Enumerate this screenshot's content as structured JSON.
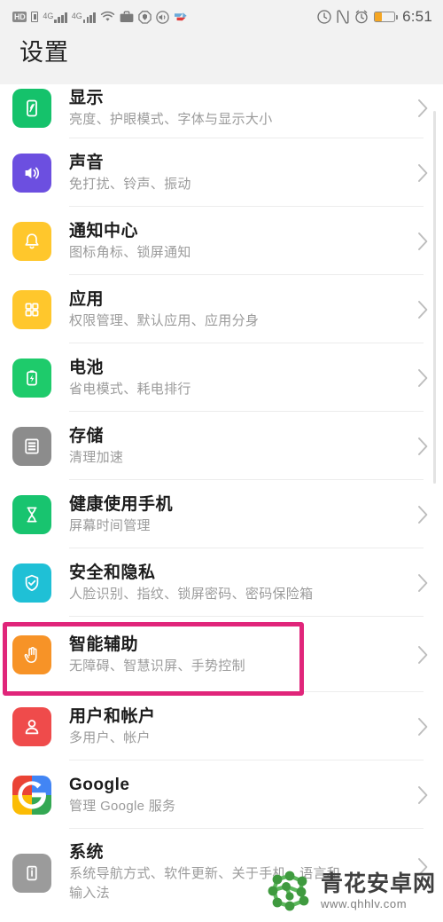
{
  "statusbar": {
    "hd_label": "HD",
    "network_label_1": "4G",
    "network_label_2": "4G",
    "time": "6:51",
    "left_icons": [
      "hd-badge",
      "sim-card-icon",
      "signal-4g-icon",
      "signal-4g-secondary-icon",
      "wifi-icon",
      "briefcase-icon",
      "shield-octagon-icon",
      "sound-off-icon",
      "app-logo-icon"
    ],
    "right_icons": [
      "data-saver-icon",
      "nfc-icon",
      "alarm-icon",
      "battery-icon"
    ],
    "battery_level_percent": 34
  },
  "header": {
    "title": "设置"
  },
  "colors": {
    "highlight": "#e0257a",
    "accent_display": "#15c26b",
    "accent_sound": "#6c4fe0",
    "accent_notification": "#ffc72c",
    "accent_apps": "#ffc72c",
    "accent_battery": "#1ecb6b",
    "accent_storage": "#8c8c8c",
    "accent_health": "#18c46f",
    "accent_security": "#1fc0d6",
    "accent_assist": "#f79327",
    "accent_users": "#ef4b4b",
    "accent_system": "#9b9b9b"
  },
  "list": {
    "items": [
      {
        "id": "display",
        "icon": "display-phone-icon",
        "title": "显示",
        "subtitle": "亮度、护眼模式、字体与显示大小",
        "chevron": "chevron-right-icon",
        "highlighted": false
      },
      {
        "id": "sound",
        "icon": "speaker-icon",
        "title": "声音",
        "subtitle": "免打扰、铃声、振动",
        "chevron": "chevron-right-icon",
        "highlighted": false
      },
      {
        "id": "notification-center",
        "icon": "bell-icon",
        "title": "通知中心",
        "subtitle": "图标角标、锁屏通知",
        "chevron": "chevron-right-icon",
        "highlighted": false
      },
      {
        "id": "apps",
        "icon": "apps-grid-icon",
        "title": "应用",
        "subtitle": "权限管理、默认应用、应用分身",
        "chevron": "chevron-right-icon",
        "highlighted": false
      },
      {
        "id": "battery",
        "icon": "battery-bolt-icon",
        "title": "电池",
        "subtitle": "省电模式、耗电排行",
        "chevron": "chevron-right-icon",
        "highlighted": false
      },
      {
        "id": "storage",
        "icon": "storage-icon",
        "title": "存储",
        "subtitle": "清理加速",
        "chevron": "chevron-right-icon",
        "highlighted": false
      },
      {
        "id": "digital-balance",
        "icon": "hourglass-icon",
        "title": "健康使用手机",
        "subtitle": "屏幕时间管理",
        "chevron": "chevron-right-icon",
        "highlighted": false
      },
      {
        "id": "security-privacy",
        "icon": "shield-check-icon",
        "title": "安全和隐私",
        "subtitle": "人脸识别、指纹、锁屏密码、密码保险箱",
        "chevron": "chevron-right-icon",
        "highlighted": false
      },
      {
        "id": "smart-assistance",
        "icon": "hand-icon",
        "title": "智能辅助",
        "subtitle": "无障碍、智慧识屏、手势控制",
        "chevron": "chevron-right-icon",
        "highlighted": true
      },
      {
        "id": "users-accounts",
        "icon": "user-icon",
        "title": "用户和帐户",
        "subtitle": "多用户、帐户",
        "chevron": "chevron-right-icon",
        "highlighted": false
      },
      {
        "id": "google",
        "icon": "google-g-icon",
        "title": "Google",
        "subtitle": "管理 Google 服务",
        "chevron": "chevron-right-icon",
        "highlighted": false
      },
      {
        "id": "system",
        "icon": "info-icon",
        "title": "系统",
        "subtitle": "系统导航方式、软件更新、关于手机、语言和",
        "subtitle2": "输入法",
        "chevron": "chevron-right-icon",
        "highlighted": false
      }
    ]
  },
  "watermark": {
    "logo": "molecule-logo-icon",
    "site_name": "青花安卓网",
    "url": "www.qhhlv.com"
  }
}
